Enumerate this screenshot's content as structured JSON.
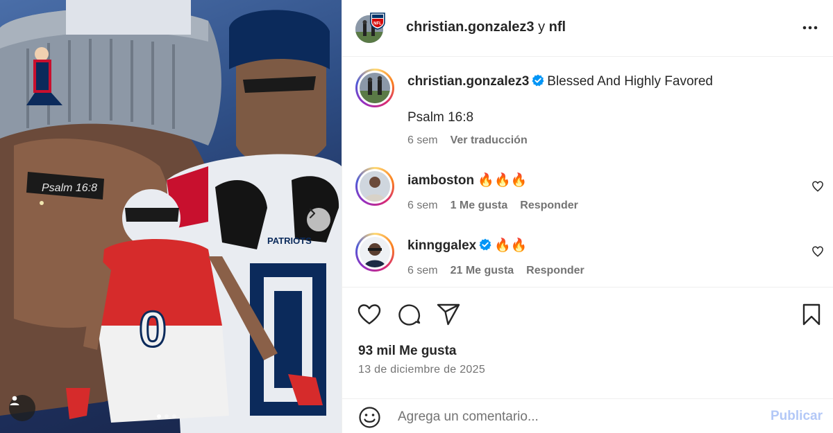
{
  "post": {
    "header": {
      "author": "christian.gonzalez3",
      "connector": "y",
      "coauthor": "nfl"
    },
    "caption": {
      "username": "christian.gonzalez3",
      "text": "Blessed And Highly Favored",
      "verse": "Psalm 16:8",
      "age": "6 sem",
      "translate_label": "Ver traducción"
    },
    "comments": [
      {
        "username": "iamboston",
        "text": "🔥🔥🔥",
        "age": "6 sem",
        "likes": "1 Me gusta",
        "reply_label": "Responder",
        "verified": false
      },
      {
        "username": "kinnggalex",
        "text": "🔥🔥",
        "age": "6 sem",
        "likes": "21 Me gusta",
        "reply_label": "Responder",
        "verified": true
      }
    ],
    "likes_total": "93 mil Me gusta",
    "date": "13 de diciembre de 2025",
    "composer": {
      "placeholder": "Agrega un comentario...",
      "publish_label": "Publicar"
    },
    "carousel": {
      "slides": 3,
      "active": 1
    },
    "image_text": {
      "eye_black": "Psalm 16:8",
      "jersey_number": "0",
      "jersey_brand": "PATRIOTS"
    }
  },
  "icons": {
    "header": [
      "nfl-logo-icon",
      "more-options-icon"
    ],
    "caption": [
      "verified-badge-icon"
    ],
    "actions": [
      "heart-icon",
      "comment-icon",
      "share-icon",
      "bookmark-icon"
    ],
    "composer": [
      "emoji-icon"
    ],
    "media": [
      "chevron-right-icon",
      "user-tag-icon"
    ]
  },
  "colors": {
    "verified": "#0095f6",
    "publish_disabled": "#b3c8f7",
    "meta": "#737373",
    "text": "#262626"
  }
}
